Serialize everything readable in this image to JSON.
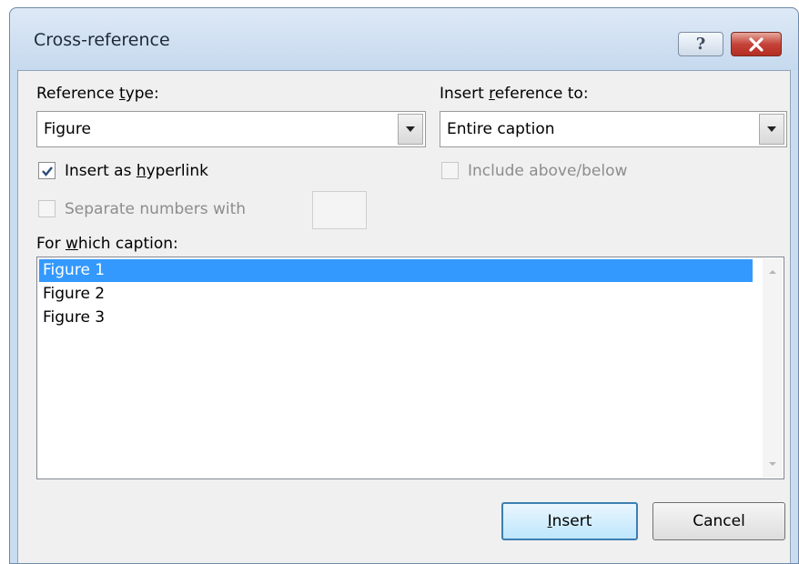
{
  "window": {
    "title": "Cross-reference",
    "help_symbol": "?",
    "close_icon": "close-icon"
  },
  "reference_type": {
    "label_before": "Reference ",
    "label_accel": "t",
    "label_after": "ype:",
    "value": "Figure"
  },
  "insert_reference_to": {
    "label_before": "Insert ",
    "label_accel": "r",
    "label_after": "eference to:",
    "value": "Entire caption"
  },
  "insert_as_hyperlink": {
    "label_before": "Insert as ",
    "label_accel": "h",
    "label_after": "yperlink",
    "checked": true
  },
  "include_above_below": {
    "label": "Include above/below",
    "checked": false,
    "enabled": false
  },
  "separate_numbers": {
    "label": "Separate numbers with",
    "value": "",
    "checked": false,
    "enabled": false
  },
  "for_which_caption": {
    "label_before": "For ",
    "label_accel": "w",
    "label_after": "hich caption:",
    "items": [
      "Figure 1",
      "Figure 2",
      "Figure 3"
    ],
    "selected_index": 0
  },
  "buttons": {
    "insert_accel": "I",
    "insert_rest": "nsert",
    "cancel": "Cancel"
  },
  "colors": {
    "selection": "#3399ff",
    "title_bar": "#c9dcf0",
    "close_button": "#c5433a",
    "dialog_background": "#f0f0f0"
  }
}
